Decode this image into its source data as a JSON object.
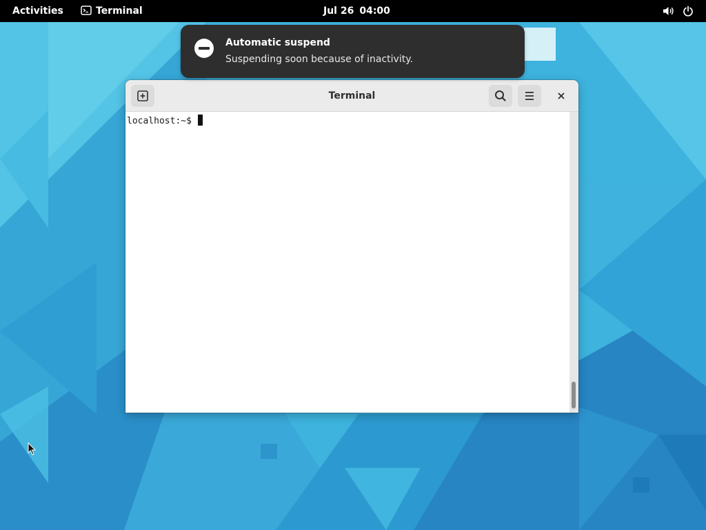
{
  "topbar": {
    "activities_label": "Activities",
    "app_name": "Terminal",
    "date": "Jul 26",
    "time": "04:00",
    "icons": [
      "terminal-app-icon",
      "volume-icon",
      "power-icon"
    ]
  },
  "notification": {
    "title": "Automatic suspend",
    "body": "Suspending soon because of inactivity.",
    "icon": "minus-circle-icon"
  },
  "terminal": {
    "window_title": "Terminal",
    "prompt": "localhost:~$",
    "header_icons": [
      "new-tab-icon",
      "search-icon",
      "hamburger-menu-icon",
      "close-icon"
    ]
  },
  "colors": {
    "topbar_bg": "#000000",
    "notification_bg": "#2e2e2e",
    "headerbar_bg": "#ebebeb",
    "wallpaper_base": "#3fb6e0"
  }
}
